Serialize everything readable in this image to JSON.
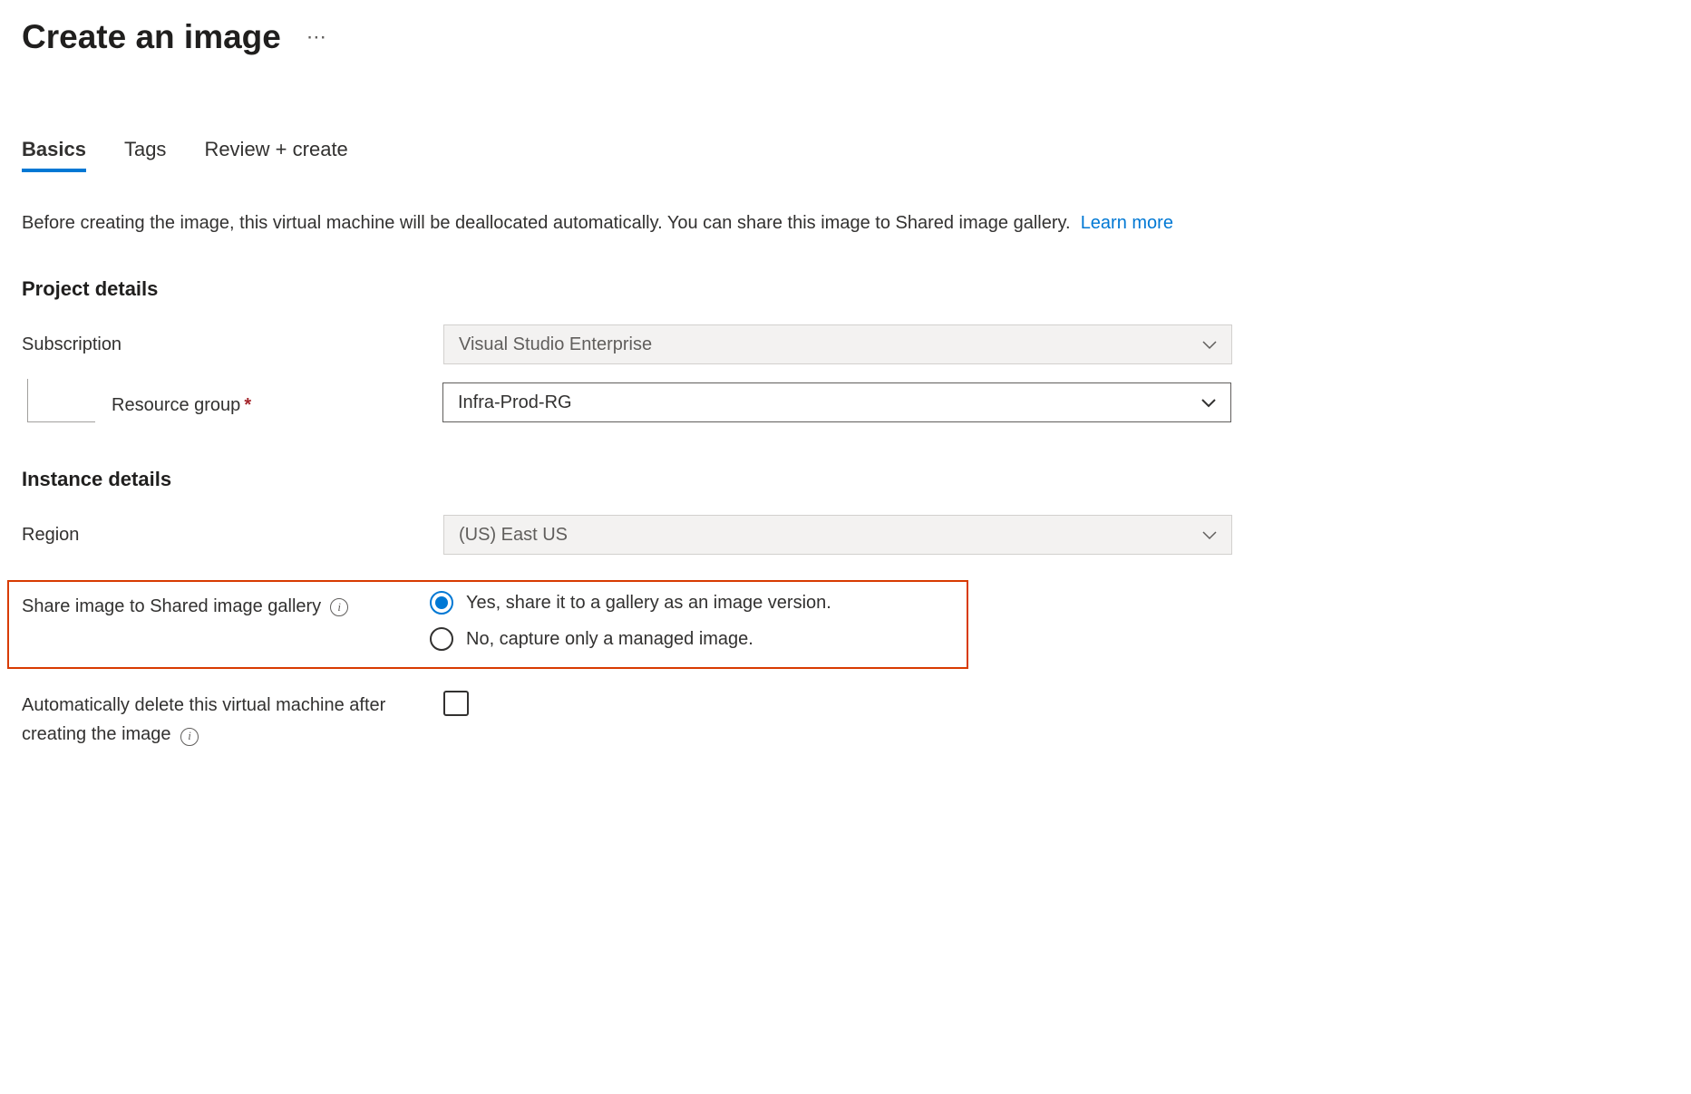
{
  "header": {
    "title": "Create an image"
  },
  "tabs": {
    "basics": "Basics",
    "tags": "Tags",
    "review": "Review + create"
  },
  "description": {
    "text": "Before creating the image, this virtual machine will be deallocated automatically. You can share this image to Shared image gallery.",
    "link": "Learn more"
  },
  "sections": {
    "project": {
      "title": "Project details",
      "subscription": {
        "label": "Subscription",
        "value": "Visual Studio Enterprise"
      },
      "resourceGroup": {
        "label": "Resource group",
        "value": "Infra-Prod-RG"
      }
    },
    "instance": {
      "title": "Instance details",
      "region": {
        "label": "Region",
        "value": "(US) East US"
      },
      "shareImage": {
        "label": "Share image to Shared image gallery",
        "options": {
          "yes": "Yes, share it to a gallery as an image version.",
          "no": "No, capture only a managed image."
        }
      },
      "autoDelete": {
        "label": "Automatically delete this virtual machine after creating the image"
      }
    }
  }
}
